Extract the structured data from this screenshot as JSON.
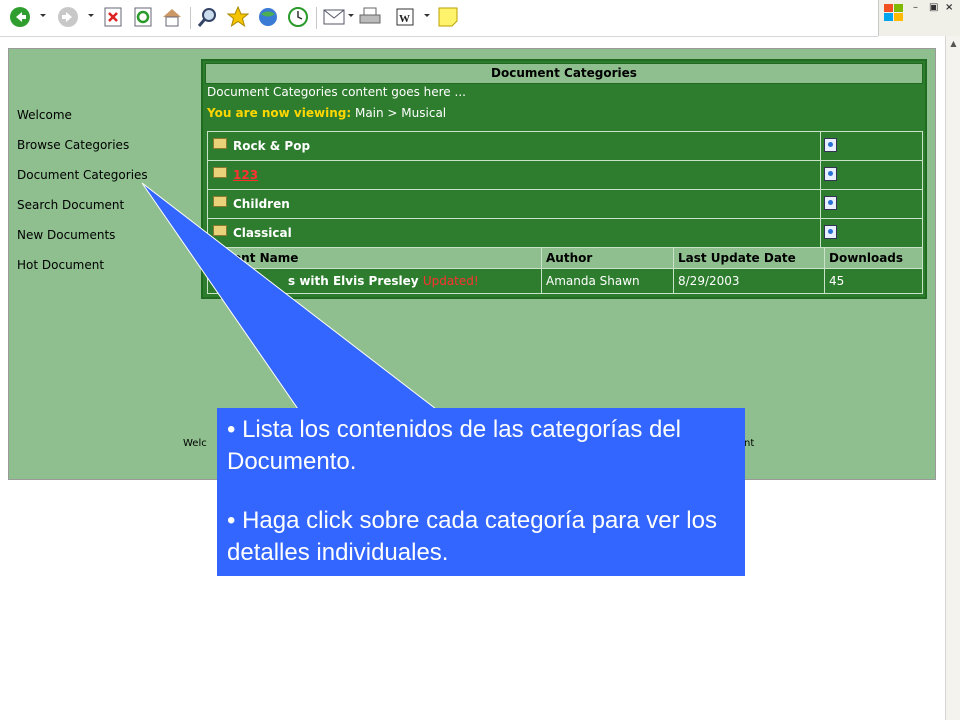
{
  "toolbar": {
    "icons": [
      "back-icon",
      "forward-icon",
      "stop-icon",
      "refresh-icon",
      "home-icon",
      "search-icon",
      "favorites-icon",
      "media-icon",
      "history-icon",
      "mail-icon",
      "print-icon",
      "word-icon",
      "note-icon"
    ]
  },
  "sidebar": {
    "items": [
      {
        "label": "Welcome"
      },
      {
        "label": "Browse Categories"
      },
      {
        "label": "Document Categories"
      },
      {
        "label": "Search Document"
      },
      {
        "label": "New Documents"
      },
      {
        "label": "Hot Document"
      }
    ]
  },
  "panel": {
    "title": "Document Categories",
    "description": "Document Categories content goes here ...",
    "viewing_label": "You are now viewing:",
    "viewing_path": "Main > Musical",
    "categories": [
      {
        "name": "Rock & Pop"
      },
      {
        "name": "123"
      },
      {
        "name": "Children"
      },
      {
        "name": "Classical"
      }
    ],
    "table": {
      "headers": [
        "ument Name",
        "Author",
        "Last Update Date",
        "Downloads"
      ],
      "rows": [
        {
          "name": "s with Elvis Presley",
          "badge": "Updated!",
          "author": "Amanda Shawn",
          "date": "8/29/2003",
          "downloads": "45"
        }
      ]
    }
  },
  "footer": {
    "left": "Welc",
    "right": "nt"
  },
  "callout": {
    "bullet1": "• Lista los contenidos de las categorías del Documento.",
    "bullet2": "• Haga click sobre cada categoría para ver los detalles individuales."
  },
  "colors": {
    "page_bg": "#8fbf8f",
    "panel_bg": "#2e7d2e",
    "callout_bg": "#3366ff",
    "accent_yellow": "#ffd700",
    "link_red": "#ff3030"
  }
}
